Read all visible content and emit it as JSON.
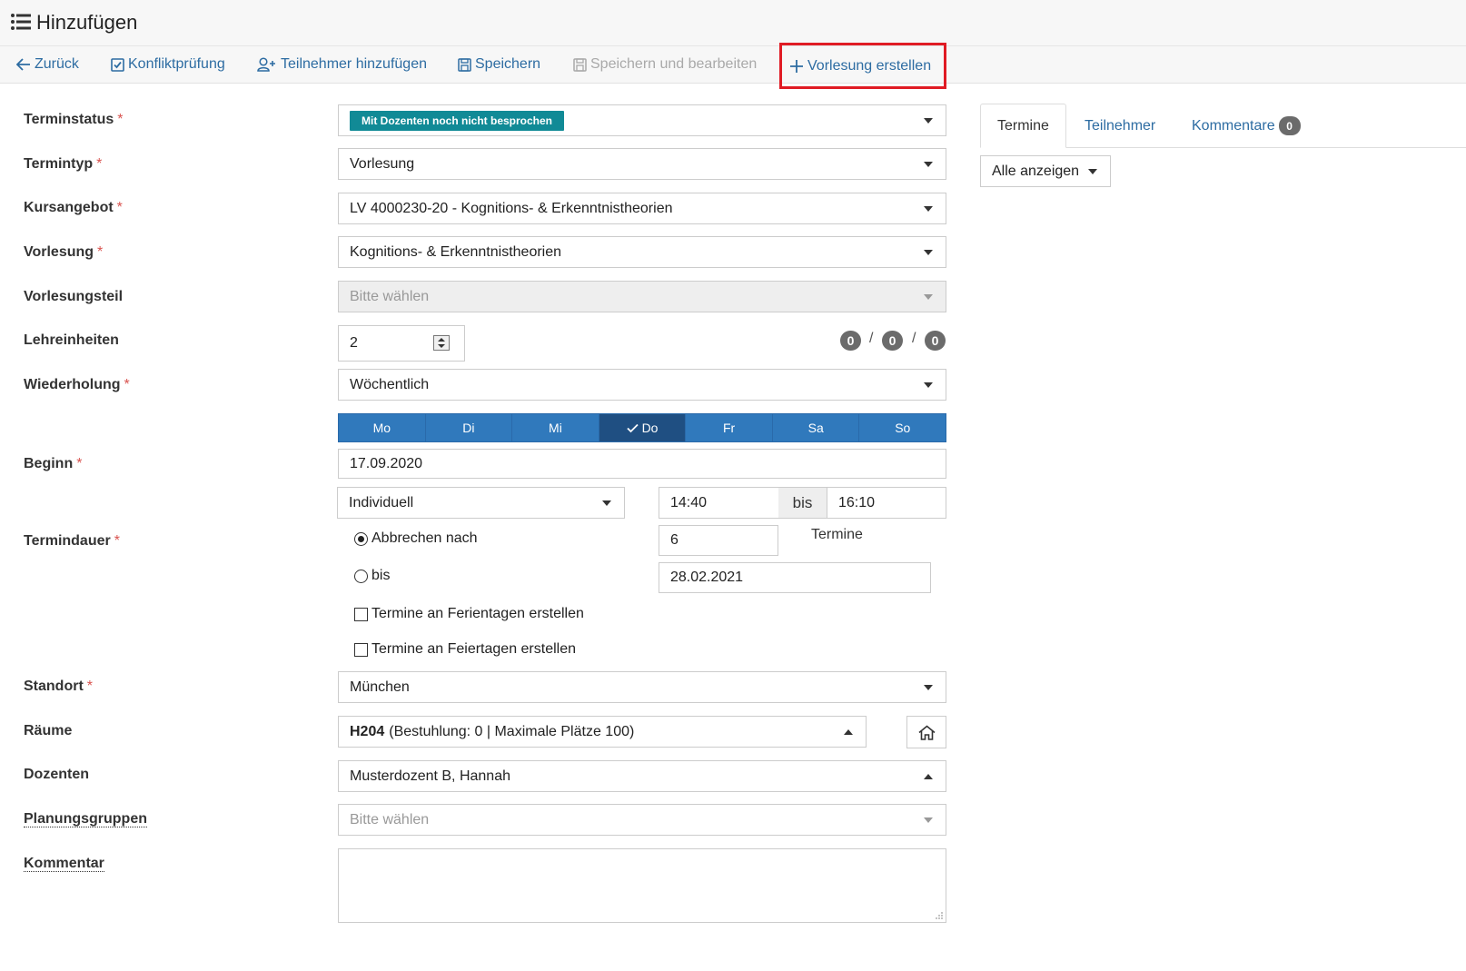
{
  "header": {
    "title": "Hinzufügen"
  },
  "toolbar": {
    "back": "Zurück",
    "conflict_check": "Konfliktprüfung",
    "add_participant": "Teilnehmer hinzufügen",
    "save": "Speichern",
    "save_and_edit": "Speichern und bearbeiten",
    "create_lecture": "Vorlesung erstellen"
  },
  "form": {
    "required_marker": "*",
    "terminstatus": {
      "label": "Terminstatus",
      "value": "Mit Dozenten noch nicht besprochen"
    },
    "termintyp": {
      "label": "Termintyp",
      "value": "Vorlesung"
    },
    "kursangebot": {
      "label": "Kursangebot",
      "value": "LV 4000230-20 - Kognitions- & Erkenntnistheorien"
    },
    "vorlesung": {
      "label": "Vorlesung",
      "value": "Kognitions- & Erkenntnistheorien"
    },
    "vorlesungsteil": {
      "label": "Vorlesungsteil",
      "placeholder": "Bitte wählen"
    },
    "lehreinheiten": {
      "label": "Lehreinheiten",
      "value": "2",
      "counts": [
        "0",
        "0",
        "0"
      ],
      "separator": "/"
    },
    "wiederholung": {
      "label": "Wiederholung",
      "value": "Wöchentlich"
    },
    "weekdays": [
      {
        "label": "Mo",
        "active": false
      },
      {
        "label": "Di",
        "active": false
      },
      {
        "label": "Mi",
        "active": false
      },
      {
        "label": "Do",
        "active": true
      },
      {
        "label": "Fr",
        "active": false
      },
      {
        "label": "Sa",
        "active": false
      },
      {
        "label": "So",
        "active": false
      }
    ],
    "beginn": {
      "label": "Beginn",
      "value": "17.09.2020"
    },
    "termindauer": {
      "label": "Termindauer",
      "mode": "Individuell",
      "time_from": "14:40",
      "time_sep": "bis",
      "time_to": "16:10",
      "abort_after_label": "Abbrechen nach",
      "abort_after_value": "6",
      "abort_after_unit": "Termine",
      "until_label": "bis",
      "until_value": "28.02.2021",
      "holidays_school": "Termine an Ferientagen erstellen",
      "holidays_public": "Termine an Feiertagen erstellen"
    },
    "standort": {
      "label": "Standort",
      "value": "München"
    },
    "raeume": {
      "label": "Räume",
      "room": "H204",
      "room_details": "(Bestuhlung: 0 | Maximale Plätze 100)"
    },
    "dozenten": {
      "label": "Dozenten",
      "value": "Musterdozent B, Hannah"
    },
    "planungsgruppen": {
      "label": "Planungsgruppen",
      "placeholder": "Bitte wählen"
    },
    "kommentar": {
      "label": "Kommentar"
    }
  },
  "right_panel": {
    "tabs": [
      {
        "label": "Termine",
        "active": true
      },
      {
        "label": "Teilnehmer",
        "active": false
      },
      {
        "label": "Kommentare",
        "active": false,
        "badge": "0"
      }
    ],
    "filter": "Alle anzeigen"
  },
  "colors": {
    "accent": "#2d6ca2",
    "status_badge": "#118a96",
    "weekday": "#3079bc",
    "weekday_active": "#1f4f82",
    "highlight_box": "#e01b24"
  }
}
